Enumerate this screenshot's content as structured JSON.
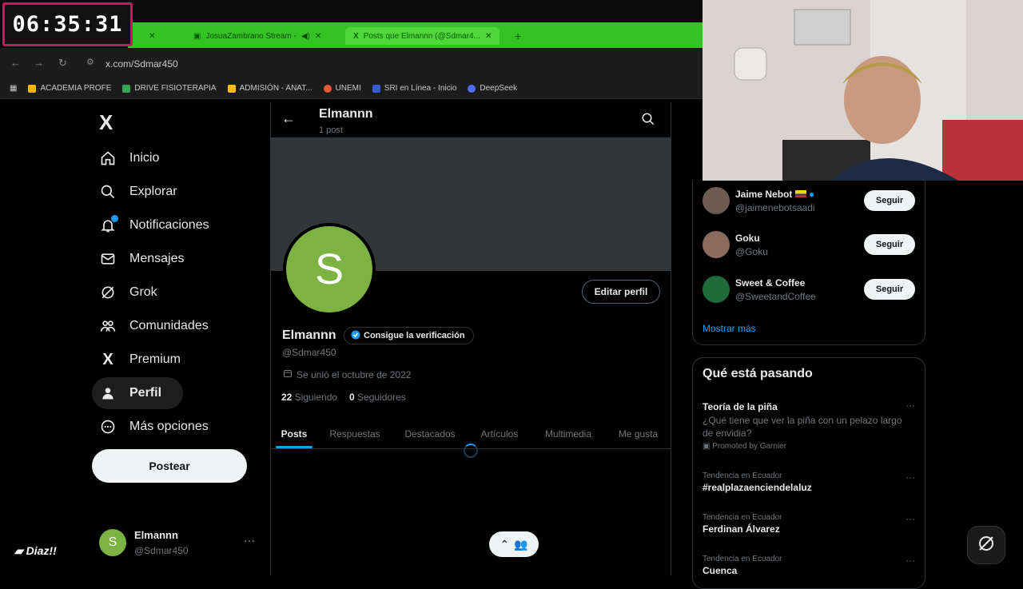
{
  "timer": "06:35:31",
  "browser": {
    "tabs": [
      {
        "label": "",
        "active": false
      },
      {
        "label": "JosuaZambrano Stream -",
        "active": false
      },
      {
        "label": "Posts que Elmannn (@Sdmar4...",
        "active": true
      }
    ],
    "url": "x.com/Sdmar450",
    "bookmarks": [
      "ACADEMIA PROFE",
      "DRIVE FISIOTERAPIA",
      "ADMISIÓN - ANAT...",
      "UNEMI",
      "SRI en Línea - Inicio",
      "DeepSeek"
    ]
  },
  "nav": {
    "logo": "X",
    "items": [
      {
        "label": "Inicio",
        "icon": "home-icon"
      },
      {
        "label": "Explorar",
        "icon": "search-icon"
      },
      {
        "label": "Notificaciones",
        "icon": "bell-icon"
      },
      {
        "label": "Mensajes",
        "icon": "mail-icon"
      },
      {
        "label": "Grok",
        "icon": "grok-icon"
      },
      {
        "label": "Comunidades",
        "icon": "people-icon"
      },
      {
        "label": "Premium",
        "icon": "x-icon"
      },
      {
        "label": "Perfil",
        "icon": "person-icon"
      },
      {
        "label": "Más opciones",
        "icon": "more-circle-icon"
      }
    ],
    "post_label": "Postear",
    "account": {
      "initial": "S",
      "name": "Elmannn",
      "handle": "@Sdmar450",
      "more": "···"
    }
  },
  "profile": {
    "header_name": "Elmannn",
    "header_posts": "1 post",
    "avatar_initial": "S",
    "edit_label": "Editar perfil",
    "name": "Elmannn",
    "verify_label": "Consigue la verificación",
    "handle": "@Sdmar450",
    "joined": "Se unió el octubre de 2022",
    "following_count": "22",
    "following_label": "Siguiendo",
    "followers_count": "0",
    "followers_label": "Seguidores",
    "tabs": [
      "Posts",
      "Respuestas",
      "Destacados",
      "Artículos",
      "Multimedia",
      "Me gusta"
    ]
  },
  "who_to_follow": {
    "items": [
      {
        "name": "Jaime Nebot",
        "handle": "@jaimenebotsaadi",
        "button": "Seguir"
      },
      {
        "name": "Goku",
        "handle": "@Goku",
        "button": "Seguir"
      },
      {
        "name": "Sweet & Coffee",
        "handle": "@SweetandCoffee",
        "button": "Seguir"
      }
    ],
    "more": "Mostrar más"
  },
  "trends": {
    "title": "Qué está pasando",
    "items": [
      {
        "meta": "",
        "title": "Teoría de la piña",
        "desc": "¿Qué tiene que ver la piña con un pelazo largo de envidia?",
        "promo": "Promoted by Garnier"
      },
      {
        "meta": "Tendencia en Ecuador",
        "title": "#realplazaenciendelaluz",
        "desc": "",
        "promo": ""
      },
      {
        "meta": "Tendencia en Ecuador",
        "title": "Ferdinan Álvarez",
        "desc": "",
        "promo": ""
      },
      {
        "meta": "Tendencia en Ecuador",
        "title": "Cuenca",
        "desc": "",
        "promo": ""
      }
    ]
  },
  "overlay": {
    "streamer_tag": "Diaz!!"
  },
  "colors": {
    "accent": "#1d9bf0",
    "avatar": "#7cb342",
    "timer_border": "#d4145a",
    "tab_green": "#35c224"
  }
}
